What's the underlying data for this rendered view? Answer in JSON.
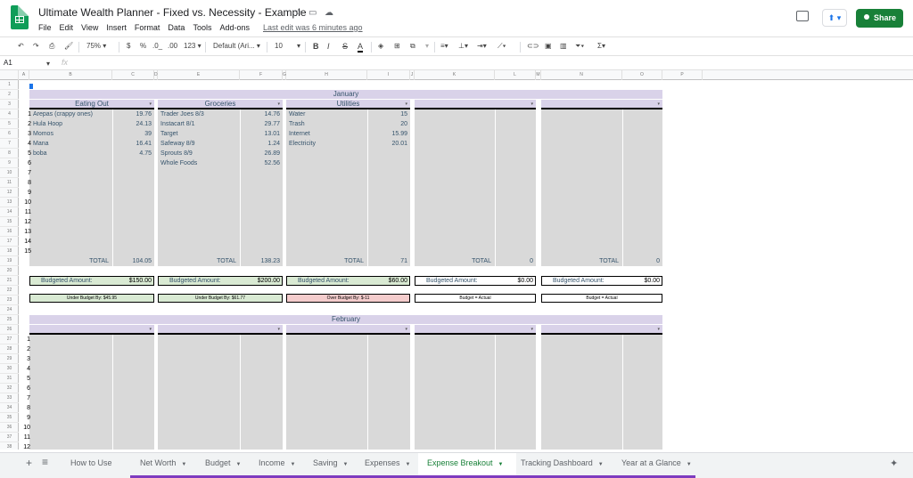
{
  "app": {
    "title": "Ultimate Wealth Planner - Fixed vs. Necessity - Example",
    "star_icon": "star-icon",
    "folder_icon": "folder-icon",
    "cloud_icon": "cloud-icon",
    "share_label": "Share"
  },
  "menu": {
    "items": [
      "File",
      "Edit",
      "View",
      "Insert",
      "Format",
      "Data",
      "Tools",
      "Add-ons",
      "Help"
    ],
    "last_edit": "Last edit was 6 minutes ago"
  },
  "toolbar": {
    "zoom": "75%",
    "currency": "$",
    "percent": "%",
    "dec_less": ".0_",
    "dec_more": ".00",
    "format_more": "123",
    "font": "Default (Ari...",
    "font_size": "10",
    "bold": "B",
    "italic": "I",
    "strike": "S",
    "text_color": "A"
  },
  "formula_bar": {
    "cell_ref": "A1",
    "fx": "fx",
    "value": ""
  },
  "columns": [
    "A",
    "B",
    "C",
    "D",
    "E",
    "F",
    "G",
    "H",
    "I",
    "J",
    "K",
    "L",
    "M",
    "N",
    "O",
    "P"
  ],
  "rows": [
    "1",
    "2",
    "3",
    "4",
    "5",
    "6",
    "7",
    "8",
    "9",
    "10",
    "11",
    "12",
    "13",
    "14",
    "15",
    "16",
    "17",
    "18",
    "19",
    "20",
    "21",
    "22",
    "23",
    "24",
    "25",
    "26",
    "27",
    "28",
    "29",
    "30",
    "31",
    "32",
    "33",
    "34",
    "35",
    "36",
    "37",
    "38"
  ],
  "sheet": {
    "month1": "January",
    "month2": "February",
    "panels": [
      {
        "category": "Eating Out",
        "items": [
          [
            "1",
            "Arepas (crappy ones)",
            "19.76"
          ],
          [
            "2",
            "Hula Hoop",
            "24.13"
          ],
          [
            "3",
            "Momos",
            "39"
          ],
          [
            "4",
            "Mana",
            "16.41"
          ],
          [
            "5",
            "boba",
            "4.75"
          ],
          [
            "6",
            "",
            ""
          ],
          [
            "7",
            "",
            ""
          ],
          [
            "8",
            "",
            ""
          ],
          [
            "9",
            "",
            ""
          ],
          [
            "10",
            "",
            ""
          ],
          [
            "11",
            "",
            ""
          ],
          [
            "12",
            "",
            ""
          ],
          [
            "13",
            "",
            ""
          ],
          [
            "14",
            "",
            ""
          ],
          [
            "15",
            "",
            ""
          ]
        ],
        "total_label": "TOTAL",
        "total": "104.05",
        "budget_label": "Budgeted Amount:",
        "budget": "$150.00",
        "status": "Under Budget By: $45.95",
        "status_color": "#d9ead3"
      },
      {
        "category": "Groceries",
        "items": [
          [
            "",
            "Trader Joes 8/3",
            "14.76"
          ],
          [
            "",
            "Instacart 8/1",
            "29.77"
          ],
          [
            "",
            "Target",
            "13.01"
          ],
          [
            "",
            "Safeway 8/9",
            "1.24"
          ],
          [
            "",
            "Sprouts 8/9",
            "26.89"
          ],
          [
            "",
            "Whole Foods",
            "52.56"
          ]
        ],
        "total_label": "TOTAL",
        "total": "138.23",
        "budget_label": "Budgeted Amount:",
        "budget": "$200.00",
        "status": "Under Budget By: $61.77",
        "status_color": "#d9ead3"
      },
      {
        "category": "Utilities",
        "items": [
          [
            "",
            "Water",
            "15"
          ],
          [
            "",
            "Trash",
            "20"
          ],
          [
            "",
            "Internet",
            "15.99"
          ],
          [
            "",
            "Electricity",
            "20.01"
          ]
        ],
        "total_label": "TOTAL",
        "total": "71",
        "budget_label": "Budgeted Amount:",
        "budget": "$60.00",
        "status": "Over Budget By: $-11",
        "status_color": "#f4cccc"
      },
      {
        "category": "",
        "items": [],
        "total_label": "TOTAL",
        "total": "0",
        "budget_label": "Budgeted Amount:",
        "budget": "$0.00",
        "status": "Budget = Actual",
        "status_color": "#ffffff"
      },
      {
        "category": "",
        "items": [],
        "total_label": "TOTAL",
        "total": "0",
        "budget_label": "Budgeted Amount:",
        "budget": "$0.00",
        "status": "Budget = Actual",
        "status_color": "#ffffff"
      }
    ],
    "feb_rows": [
      "1",
      "2",
      "3",
      "4",
      "5",
      "6",
      "7",
      "8",
      "9",
      "10",
      "11",
      "12"
    ]
  },
  "tabs": {
    "add": "+",
    "list": "≡",
    "items": [
      "How to Use",
      "Net Worth",
      "Budget",
      "Income",
      "Saving",
      "Expenses",
      "Expense Breakout",
      "Tracking Dashboard",
      "Year at a Glance"
    ],
    "active": "Expense Breakout"
  },
  "colors": {
    "header_purple": "#d9d2e9",
    "panel_gray": "#d9d9d9",
    "text_blue": "#35536b",
    "under_green": "#d9ead3",
    "over_red": "#f4cccc",
    "share_green": "#188038",
    "active_tab": "#188038"
  }
}
